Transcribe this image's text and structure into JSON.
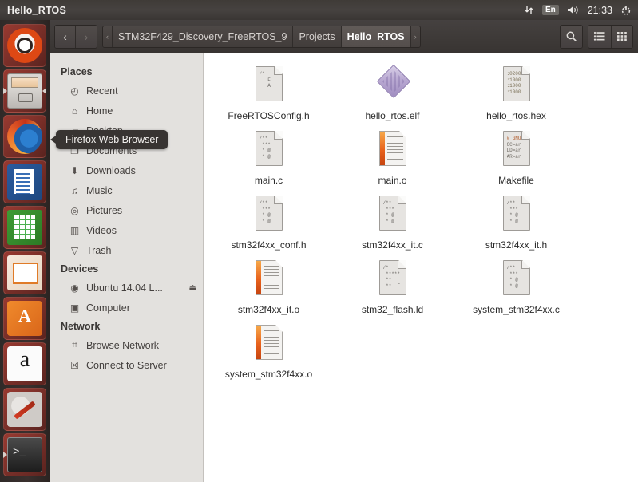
{
  "panel": {
    "title": "Hello_RTOS",
    "indicators": {
      "network_icon": "network-updown-icon",
      "keyboard": "En",
      "volume_icon": "volume-icon",
      "clock": "21:33",
      "session_icon": "session-gear-icon"
    }
  },
  "launcher": {
    "items": [
      {
        "name": "ubuntu-dash",
        "label": "Dash home"
      },
      {
        "name": "files",
        "label": "Files"
      },
      {
        "name": "firefox",
        "label": "Firefox Web Browser"
      },
      {
        "name": "libreoffice-writer",
        "label": "LibreOffice Writer"
      },
      {
        "name": "libreoffice-calc",
        "label": "LibreOffice Calc"
      },
      {
        "name": "libreoffice-impress",
        "label": "LibreOffice Impress"
      },
      {
        "name": "ubuntu-software-center",
        "label": "Ubuntu Software Center"
      },
      {
        "name": "amazon",
        "label": "Amazon"
      },
      {
        "name": "system-settings",
        "label": "System Settings"
      },
      {
        "name": "terminal",
        "label": "Terminal"
      }
    ]
  },
  "toolbar": {
    "back_label": "‹",
    "forward_label": "›",
    "crumb_prev_label": "‹",
    "crumb_next_label": "›",
    "breadcrumbs": [
      {
        "label": "STM32F429_Discovery_FreeRTOS_9",
        "active": false
      },
      {
        "label": "Projects",
        "active": false
      },
      {
        "label": "Hello_RTOS",
        "active": true
      }
    ],
    "search_label": "⌕",
    "list_view_label": "☰",
    "icon_view_label": "∷"
  },
  "sidebar": {
    "sections": [
      {
        "header": "Places",
        "items": [
          {
            "label": "Recent",
            "icon": "clock-icon",
            "glyph": "◴"
          },
          {
            "label": "Home",
            "icon": "home-icon",
            "glyph": "⌂"
          },
          {
            "label": "Desktop",
            "icon": "folder-icon",
            "glyph": "▰"
          },
          {
            "label": "Documents",
            "icon": "documents-icon",
            "glyph": "❐"
          },
          {
            "label": "Downloads",
            "icon": "download-icon",
            "glyph": "⬇"
          },
          {
            "label": "Music",
            "icon": "music-icon",
            "glyph": "♫"
          },
          {
            "label": "Pictures",
            "icon": "camera-icon",
            "glyph": "◎"
          },
          {
            "label": "Videos",
            "icon": "film-icon",
            "glyph": "▥"
          },
          {
            "label": "Trash",
            "icon": "trash-icon",
            "glyph": "▽"
          }
        ]
      },
      {
        "header": "Devices",
        "items": [
          {
            "label": "Ubuntu 14.04 L...",
            "icon": "disc-icon",
            "glyph": "◉",
            "eject": "⏏"
          },
          {
            "label": "Computer",
            "icon": "computer-icon",
            "glyph": "▣"
          }
        ]
      },
      {
        "header": "Network",
        "items": [
          {
            "label": "Browse Network",
            "icon": "network-icon",
            "glyph": "⌗"
          },
          {
            "label": "Connect to Server",
            "icon": "server-icon",
            "glyph": "☒"
          }
        ]
      }
    ]
  },
  "tooltip": {
    "text": "Firefox Web Browser"
  },
  "files": [
    {
      "name": "FreeRTOSConfig.h",
      "kind": "code",
      "preview": [
        "/*",
        "   F",
        "   A"
      ]
    },
    {
      "name": "hello_rtos.elf",
      "kind": "elf",
      "preview": []
    },
    {
      "name": "hello_rtos.hex",
      "kind": "hex",
      "preview": [
        ":0200",
        ":1000",
        ":1000",
        ":1000"
      ]
    },
    {
      "name": "main.c",
      "kind": "code",
      "preview": [
        "/**",
        " ***",
        " * @",
        " * @"
      ]
    },
    {
      "name": "main.o",
      "kind": "object",
      "preview": []
    },
    {
      "name": "Makefile",
      "kind": "makefile",
      "preview": [
        "# GNU",
        "CC=ar",
        "LD=ar",
        "AR=ar"
      ]
    },
    {
      "name": "stm32f4xx_conf.h",
      "kind": "code",
      "preview": [
        "/**",
        " ***",
        " * @",
        " * @"
      ]
    },
    {
      "name": "stm32f4xx_it.c",
      "kind": "code",
      "preview": [
        "/**",
        " ***",
        " * @",
        " * @"
      ]
    },
    {
      "name": "stm32f4xx_it.h",
      "kind": "code",
      "preview": [
        "/**",
        " ***",
        " * @",
        " * @"
      ]
    },
    {
      "name": "stm32f4xx_it.o",
      "kind": "object",
      "preview": []
    },
    {
      "name": "stm32_flash.ld",
      "kind": "code",
      "preview": [
        "/*",
        " *****",
        " **",
        " **  F"
      ]
    },
    {
      "name": "system_stm32f4xx.c",
      "kind": "code",
      "preview": [
        "/**",
        " ***",
        " * @",
        " * @"
      ]
    },
    {
      "name": "system_stm32f4xx.o",
      "kind": "object",
      "preview": []
    }
  ],
  "colors": {
    "panel_bg": "#403c3a",
    "launcher_bg": "#332b29",
    "sidebar_bg": "#e3e1de",
    "content_bg": "#ffffff",
    "accent_orange": "#dd4814",
    "tooltip_bg": "#383432"
  }
}
